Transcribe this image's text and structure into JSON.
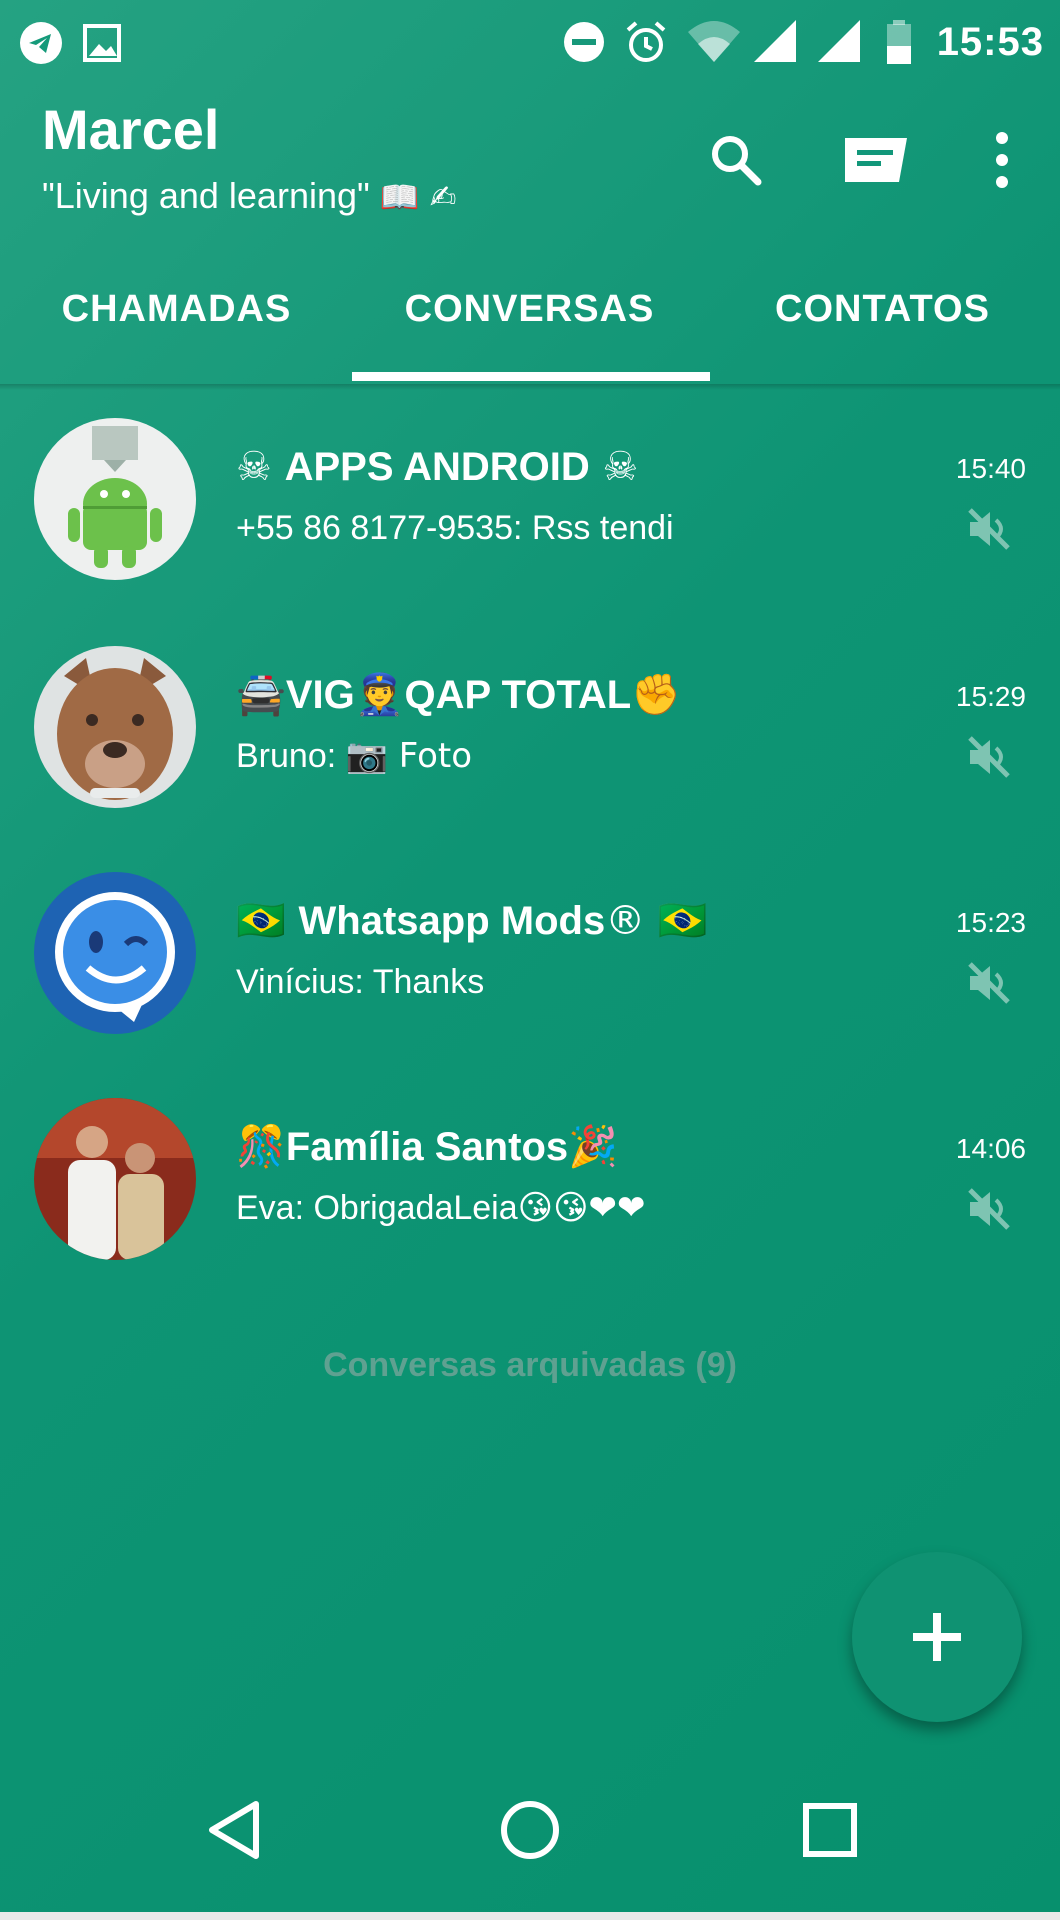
{
  "status_bar": {
    "time": "15:53"
  },
  "app_bar": {
    "user_name": "Marcel",
    "user_status": "\"Living and learning\"",
    "user_status_emojis": "📖 ✍",
    "actions": [
      "search-icon",
      "new-chat-icon",
      "more-vertical-icon"
    ]
  },
  "tabs": [
    {
      "label": "CHAMADAS",
      "selected": false
    },
    {
      "label": "CONVERSAS",
      "selected": true
    },
    {
      "label": "CONTATOS",
      "selected": false
    }
  ],
  "chats": [
    {
      "name_prefix": "☠ ",
      "name": "APPS ANDROID",
      "name_suffix": " ☠",
      "preview": "+55 86 8177-9535: Rss tendi",
      "preview_emoji": "",
      "time": "15:40",
      "muted": true
    },
    {
      "name_prefix": "🚔",
      "name": "VIG👮QAP TOTAL",
      "name_suffix": "✊",
      "preview": "Bruno: ",
      "preview_emoji": "📷 Foto",
      "time": "15:29",
      "muted": true
    },
    {
      "name_prefix": "🇧🇷 ",
      "name": "Whatsapp Mods",
      "name_suffix": "® 🇧🇷",
      "preview": "Vinícius: Thanks",
      "preview_emoji": "",
      "time": "15:23",
      "muted": true
    },
    {
      "name_prefix": "🎊",
      "name": "Família Santos",
      "name_suffix": "🎉",
      "preview": "Eva: ObrigadaLeia",
      "preview_emoji": "😘😘❤❤",
      "time": "14:06",
      "muted": true
    }
  ],
  "archived_label": "Conversas arquivadas (9)",
  "fab_icon": "plus-icon",
  "nav": [
    "back-icon",
    "home-icon",
    "recents-icon"
  ],
  "colors": {
    "primary": "#0e9474",
    "archived_text": "#5fa191",
    "mute_icon": "#7ec4b2",
    "heart": "#d83a3a",
    "kiss": "#f5c33b"
  }
}
